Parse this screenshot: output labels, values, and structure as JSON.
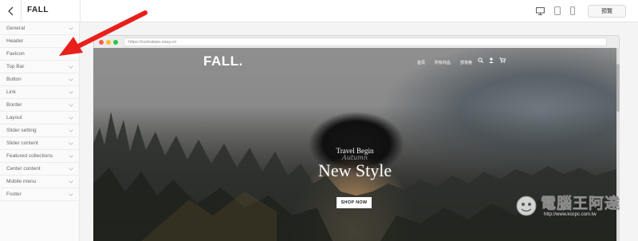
{
  "header": {
    "title": "FALL",
    "preview_label": "預覽",
    "device_icons": [
      "desktop-icon",
      "tablet-icon",
      "mobile-icon"
    ]
  },
  "sidebar": {
    "items": [
      {
        "label": "General",
        "has_chevron": true
      },
      {
        "label": "Header",
        "has_chevron": false
      },
      {
        "label": "Favicon",
        "has_chevron": false
      },
      {
        "label": "Top Bar",
        "has_chevron": true
      },
      {
        "label": "Button",
        "has_chevron": true
      },
      {
        "label": "Link",
        "has_chevron": true
      },
      {
        "label": "Border",
        "has_chevron": true
      },
      {
        "label": "Layout",
        "has_chevron": true
      },
      {
        "label": "Slider setting",
        "has_chevron": true
      },
      {
        "label": "Slider content",
        "has_chevron": true
      },
      {
        "label": "Featured collections",
        "has_chevron": true
      },
      {
        "label": "Center content",
        "has_chevron": true
      },
      {
        "label": "Mobile menu",
        "has_chevron": true
      },
      {
        "label": "Footer",
        "has_chevron": true
      }
    ]
  },
  "browser": {
    "url": "https://rocksteps.easy.co",
    "dot_colors": [
      "#ff5f57",
      "#febc2e",
      "#28c840"
    ]
  },
  "site": {
    "logo": "FALL.",
    "nav_links": [
      "首頁",
      "所有商品",
      "部落格"
    ],
    "nav_icons": [
      "search-icon",
      "user-icon",
      "cart-icon"
    ],
    "hero_small_title": "Travel Begin",
    "hero_script": "Autumn",
    "hero_title": "New Style",
    "cta_label": "SHOP NOW"
  },
  "watermark": {
    "text": "電腦王阿達",
    "url": "http://www.kocpc.com.tw"
  },
  "colors": {
    "arrow": "#e8201c",
    "accent_text": "#222222"
  }
}
